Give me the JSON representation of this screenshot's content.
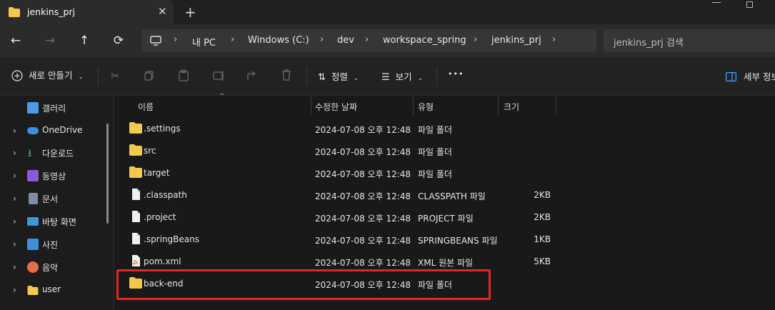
{
  "window": {
    "tab_title": "jenkins_prj",
    "tab_close": "✕",
    "new_tab": "+"
  },
  "nav": {
    "back": "←",
    "forward": "→",
    "up": "↑",
    "refresh": "⟳",
    "breadcrumbs": [
      "내 PC",
      "Windows (C:)",
      "dev",
      "workspace_spring",
      "jenkins_prj"
    ],
    "separator": "›",
    "search_placeholder": "jenkins_prj 검색"
  },
  "commands": {
    "new_label": "새로 만들기",
    "sort_label": "정렬",
    "view_label": "보기",
    "more_label": "•••",
    "details_label": "세부 정보"
  },
  "sidebar": {
    "items": [
      {
        "label": "갤러리",
        "icon": "gallery-icon",
        "color": "#4a9ce8",
        "chevron": false
      },
      {
        "label": "OneDrive",
        "icon": "onedrive-icon",
        "color": "#3a8ee6",
        "chevron": true
      },
      {
        "label": "다운로드",
        "icon": "download-icon",
        "color": "#3fb27f",
        "chevron": true
      },
      {
        "label": "동영상",
        "icon": "video-icon",
        "color": "#8a5bd6",
        "chevron": true
      },
      {
        "label": "문서",
        "icon": "document-icon",
        "color": "#7c8ea8",
        "chevron": true
      },
      {
        "label": "바탕 화면",
        "icon": "desktop-icon",
        "color": "#3a9ad9",
        "chevron": true
      },
      {
        "label": "사진",
        "icon": "photo-icon",
        "color": "#3c8fd8",
        "chevron": true
      },
      {
        "label": "음악",
        "icon": "music-icon",
        "color": "#e0704a",
        "chevron": true
      },
      {
        "label": "user",
        "icon": "folder-icon",
        "color": "#f2c94c",
        "chevron": true
      }
    ]
  },
  "table": {
    "headers": {
      "name": "이름",
      "modified": "수정한 날짜",
      "type": "유형",
      "size": "크기"
    },
    "rows": [
      {
        "name": ".settings",
        "modified": "2024-07-08 오후 12:48",
        "type": "파일 폴더",
        "size": "",
        "icon": "folder-icon"
      },
      {
        "name": "src",
        "modified": "2024-07-08 오후 12:48",
        "type": "파일 폴더",
        "size": "",
        "icon": "folder-icon"
      },
      {
        "name": "target",
        "modified": "2024-07-08 오후 12:48",
        "type": "파일 폴더",
        "size": "",
        "icon": "folder-icon"
      },
      {
        "name": ".classpath",
        "modified": "2024-07-08 오후 12:48",
        "type": "CLASSPATH 파일",
        "size": "2KB",
        "icon": "file-icon"
      },
      {
        "name": ".project",
        "modified": "2024-07-08 오후 12:48",
        "type": "PROJECT 파일",
        "size": "2KB",
        "icon": "file-icon"
      },
      {
        "name": ".springBeans",
        "modified": "2024-07-08 오후 12:48",
        "type": "SPRINGBEANS 파일",
        "size": "1KB",
        "icon": "file-icon"
      },
      {
        "name": "pom.xml",
        "modified": "2024-07-08 오후 12:48",
        "type": "XML 원본 파일",
        "size": "5KB",
        "icon": "xml-file-icon"
      },
      {
        "name": "back-end",
        "modified": "2024-07-08 오후 12:48",
        "type": "파일 폴더",
        "size": "",
        "icon": "folder-icon"
      }
    ]
  },
  "colors": {
    "highlight": "#e0262a",
    "folder": "#f2c94c"
  }
}
